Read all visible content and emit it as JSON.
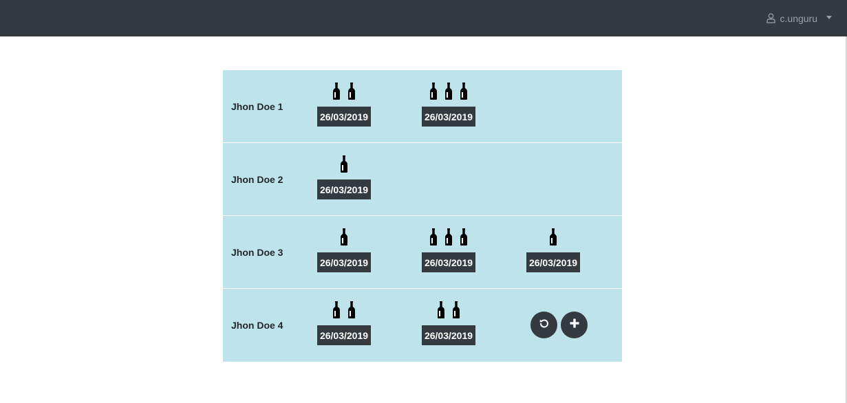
{
  "navbar": {
    "user_icon": "user-outline-icon",
    "username": "c.unguru",
    "dropdown_icon": "caret-down-icon"
  },
  "rows": [
    {
      "name": "Jhon Doe 1",
      "entries": [
        {
          "bottles": 2,
          "date": "26/03/2019"
        },
        {
          "bottles": 3,
          "date": "26/03/2019"
        }
      ]
    },
    {
      "name": "Jhon Doe 2",
      "entries": [
        {
          "bottles": 1,
          "date": "26/03/2019"
        }
      ]
    },
    {
      "name": "Jhon Doe 3",
      "entries": [
        {
          "bottles": 1,
          "date": "26/03/2019"
        },
        {
          "bottles": 3,
          "date": "26/03/2019"
        },
        {
          "bottles": 1,
          "date": "26/03/2019"
        }
      ]
    },
    {
      "name": "Jhon Doe 4",
      "entries": [
        {
          "bottles": 2,
          "date": "26/03/2019"
        },
        {
          "bottles": 2,
          "date": "26/03/2019"
        }
      ]
    }
  ],
  "actions": {
    "reset_icon": "undo-icon",
    "add_icon": "plus-icon"
  },
  "colors": {
    "navbar": "#343a40",
    "table_background": "#bee3ea",
    "badge": "#343a40"
  }
}
